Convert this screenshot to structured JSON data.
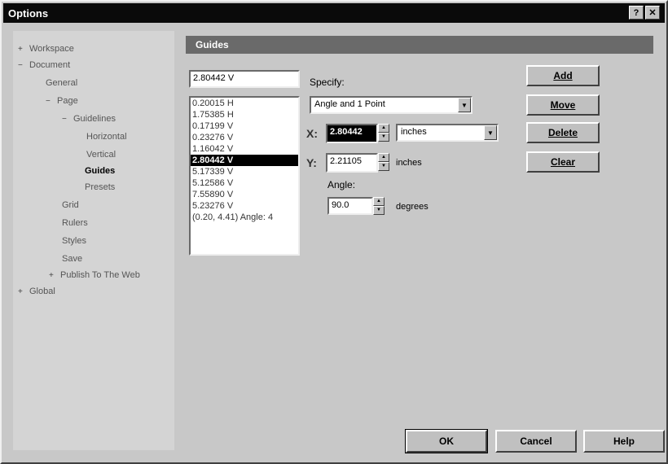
{
  "window": {
    "title": "Options",
    "help_btn": "?",
    "close_btn": "✕"
  },
  "tree": {
    "items": [
      {
        "label": "Workspace",
        "exp": "+"
      },
      {
        "label": "Document",
        "exp": "−"
      },
      {
        "label": "General",
        "exp": ""
      },
      {
        "label": "Page",
        "exp": "−"
      },
      {
        "label": "Guidelines",
        "exp": "−"
      },
      {
        "label": "Horizontal",
        "exp": ""
      },
      {
        "label": "Vertical",
        "exp": ""
      },
      {
        "label": "Guides",
        "exp": ""
      },
      {
        "label": "Presets",
        "exp": ""
      },
      {
        "label": "Grid",
        "exp": ""
      },
      {
        "label": "Rulers",
        "exp": ""
      },
      {
        "label": "Styles",
        "exp": ""
      },
      {
        "label": "Save",
        "exp": ""
      },
      {
        "label": "Publish To The Web",
        "exp": "+"
      },
      {
        "label": "Global",
        "exp": "+"
      }
    ]
  },
  "panel": {
    "header": "Guides",
    "top_value": "2.80442 V",
    "guides": [
      "0.20015 H",
      "1.75385 H",
      "0.17199 V",
      "0.23276 V",
      "1.16042 V",
      "2.80442 V",
      "5.17339 V",
      "5.12586 V",
      "7.55890 V",
      "5.23276 V",
      "(0.20, 4.41) Angle: 4"
    ],
    "selected_index": 5,
    "specify_label": "Specify:",
    "specify_value": "Angle and 1 Point",
    "x_label": "X:",
    "x_value": "2.80442",
    "x_unit": "inches",
    "y_label": "Y:",
    "y_value": "2.21105",
    "y_unit": "inches",
    "angle_label": "Angle:",
    "angle_value": "90.0",
    "angle_unit": "degrees",
    "buttons": {
      "add": "Add",
      "move": "Move",
      "delete": "Delete",
      "clear": "Clear"
    }
  },
  "footer": {
    "ok": "OK",
    "cancel": "Cancel",
    "help": "Help"
  }
}
